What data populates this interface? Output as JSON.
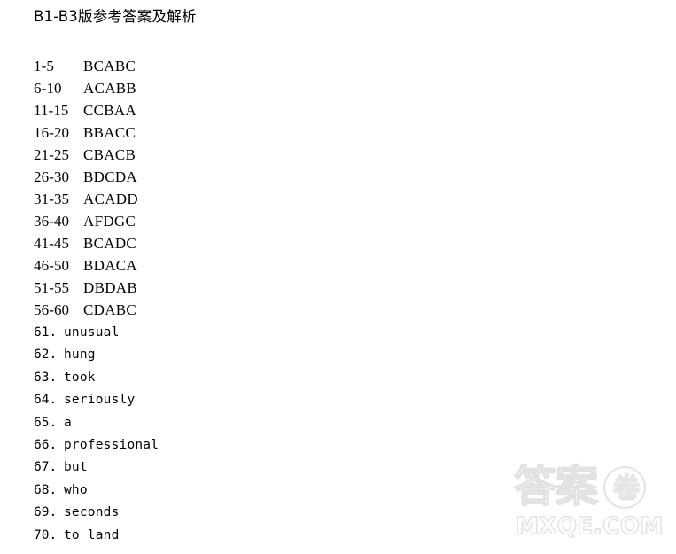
{
  "page": {
    "background_color": "#ffffff",
    "text_color": "#000000",
    "title": "B1-B3版参考答案及解析"
  },
  "answers": {
    "rows": [
      {
        "range": "1-5",
        "letters": "BCABC"
      },
      {
        "range": "6-10",
        "letters": "ACABB"
      },
      {
        "range": "11-15",
        "letters": "CCBAA"
      },
      {
        "range": "16-20",
        "letters": "BBACC"
      },
      {
        "range": "21-25",
        "letters": "CBACB"
      },
      {
        "range": "26-30",
        "letters": "BDCDA"
      },
      {
        "range": "31-35",
        "letters": "ACADD"
      },
      {
        "range": "36-40",
        "letters": "AFDGC"
      },
      {
        "range": "41-45",
        "letters": "BCADC"
      },
      {
        "range": "46-50",
        "letters": "BDACA"
      },
      {
        "range": "51-55",
        "letters": "DBDAB"
      },
      {
        "range": "56-60",
        "letters": "CDABC"
      }
    ]
  },
  "fills": {
    "rows": [
      {
        "num": "61.",
        "word": "unusual"
      },
      {
        "num": "62.",
        "word": "hung"
      },
      {
        "num": "63.",
        "word": "took"
      },
      {
        "num": "64.",
        "word": "seriously"
      },
      {
        "num": "65.",
        "word": "a"
      },
      {
        "num": "66.",
        "word": "professional"
      },
      {
        "num": "67.",
        "word": "but"
      },
      {
        "num": "68.",
        "word": "who"
      },
      {
        "num": "69.",
        "word": "seconds"
      },
      {
        "num": "70.",
        "word": "to land"
      }
    ]
  },
  "watermark": {
    "cjk": "答案",
    "badge_char": "卷",
    "domain": "MXQE.COM",
    "color": "#e4e4e4"
  }
}
